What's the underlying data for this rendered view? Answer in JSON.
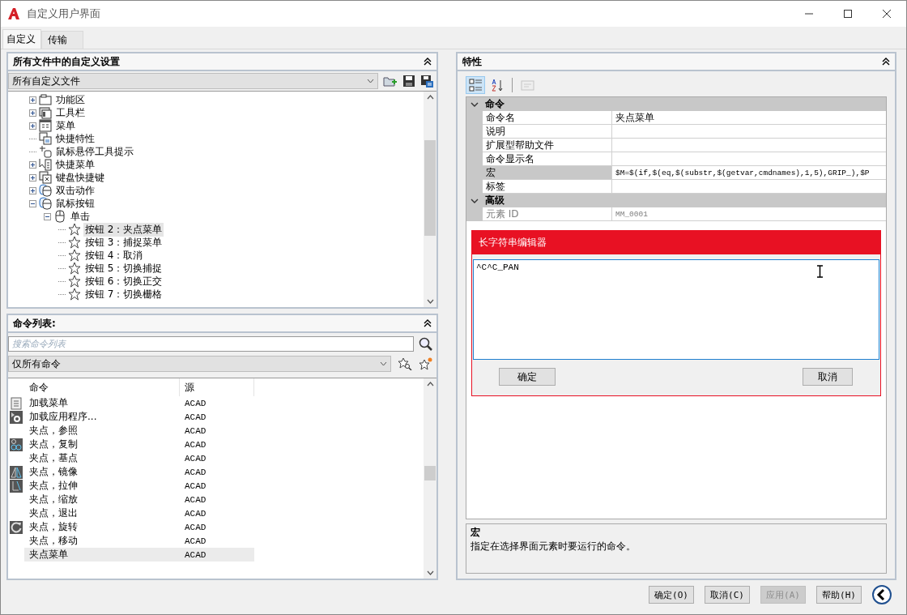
{
  "window": {
    "title": "自定义用户界面"
  },
  "tabs": [
    {
      "label": "自定义",
      "selected": true
    },
    {
      "label": "传输",
      "selected": false
    }
  ],
  "customizations_panel": {
    "title": "所有文件中的自定义设置",
    "file_filter": "所有自定义文件",
    "tree": [
      {
        "kind": "ribbon",
        "label": "功能区",
        "expanded": false,
        "selected": false
      },
      {
        "kind": "toolbar",
        "label": "工具栏",
        "expanded": false,
        "selected": false
      },
      {
        "kind": "menu",
        "label": "菜单",
        "expanded": false,
        "selected": false
      },
      {
        "kind": "quickprops",
        "label": "快捷特性",
        "selected": false
      },
      {
        "kind": "tooltip",
        "label": "鼠标悬停工具提示",
        "selected": false
      },
      {
        "kind": "shortcut",
        "label": "快捷菜单",
        "expanded": false,
        "selected": false
      },
      {
        "kind": "keyboard",
        "label": "键盘快捷键",
        "expanded": false,
        "selected": false
      },
      {
        "kind": "mice",
        "label": "双击动作",
        "expanded": false,
        "selected": false
      },
      {
        "kind": "mice",
        "label": "鼠标按钮",
        "expanded": true,
        "selected": false,
        "children": [
          {
            "kind": "mouse",
            "label": "单击",
            "expanded": true,
            "selected": false,
            "children": [
              {
                "kind": "star",
                "label": "按钮 2：夹点菜单",
                "selected": true
              },
              {
                "kind": "star",
                "label": "按钮 3：捕捉菜单",
                "selected": false
              },
              {
                "kind": "star",
                "label": "按钮 4：取消",
                "selected": false
              },
              {
                "kind": "star",
                "label": "按钮 5：切换捕捉",
                "selected": false
              },
              {
                "kind": "star",
                "label": "按钮 6：切换正交",
                "selected": false
              },
              {
                "kind": "star",
                "label": "按钮 7：切换栅格",
                "selected": false
              }
            ]
          }
        ]
      }
    ]
  },
  "command_list_panel": {
    "title": "命令列表:",
    "search": {
      "placeholder": "搜索命令列表"
    },
    "filter": "仅所有命令",
    "columns": [
      "命令",
      "源"
    ],
    "rows": [
      {
        "kind": "menu",
        "command": "加载菜单",
        "source": "ACAD",
        "selected": false
      },
      {
        "kind": "app",
        "command": "加载应用程序...",
        "source": "ACAD",
        "selected": false
      },
      {
        "kind": "plain",
        "command": "夹点，参照",
        "source": "ACAD",
        "selected": false
      },
      {
        "kind": "copy",
        "command": "夹点，复制",
        "source": "ACAD",
        "selected": false
      },
      {
        "kind": "plain",
        "command": "夹点，基点",
        "source": "ACAD",
        "selected": false
      },
      {
        "kind": "mirror",
        "command": "夹点，镜像",
        "source": "ACAD",
        "selected": false
      },
      {
        "kind": "stretch",
        "command": "夹点，拉伸",
        "source": "ACAD",
        "selected": false
      },
      {
        "kind": "plain",
        "command": "夹点，缩放",
        "source": "ACAD",
        "selected": false
      },
      {
        "kind": "plain",
        "command": "夹点，退出",
        "source": "ACAD",
        "selected": false
      },
      {
        "kind": "rotate",
        "command": "夹点，旋转",
        "source": "ACAD",
        "selected": false
      },
      {
        "kind": "plain",
        "command": "夹点，移动",
        "source": "ACAD",
        "selected": false
      },
      {
        "kind": "plain",
        "command": "夹点菜单",
        "source": "ACAD",
        "selected": true
      }
    ]
  },
  "properties_panel": {
    "title": "特性",
    "toolbar": [
      {
        "kind": "categorized",
        "selected": true,
        "disabled": false
      },
      {
        "kind": "alphabetical",
        "selected": false,
        "disabled": false
      },
      {
        "kind": "pages",
        "selected": false,
        "disabled": true
      }
    ],
    "categories": [
      {
        "name": "命令",
        "expanded": true,
        "rows": [
          {
            "name": "命令名",
            "value": "夹点菜单",
            "selected": false,
            "disabled": false
          },
          {
            "name": "说明",
            "selected": false,
            "disabled": false
          },
          {
            "name": "扩展型帮助文件",
            "selected": false,
            "disabled": false
          },
          {
            "name": "命令显示名",
            "selected": false,
            "disabled": false
          },
          {
            "name": "宏",
            "value": "$M=$(if,$(eq,$(substr,$(getvar,cmdnames),1,5),GRIP_),$P",
            "selected": true,
            "disabled": false
          },
          {
            "name": "标签",
            "selected": false,
            "disabled": false
          }
        ]
      },
      {
        "name": "高级",
        "expanded": true,
        "rows": [
          {
            "name": "元素 ID",
            "value": "MM_0001",
            "selected": false,
            "disabled": true
          }
        ]
      }
    ],
    "string_editor": {
      "title": "长字符串编辑器",
      "value": "^C^C_PAN",
      "buttons": [
        "确定",
        "取消"
      ]
    },
    "description": {
      "title": "宏",
      "text": "指定在选择界面元素时要运行的命令。"
    }
  },
  "buttons": [
    {
      "label": "确定(O)",
      "disabled": false
    },
    {
      "label": "取消(C)",
      "disabled": false
    },
    {
      "label": "应用(A)",
      "disabled": true
    },
    {
      "label": "帮助(H)",
      "disabled": false
    }
  ]
}
